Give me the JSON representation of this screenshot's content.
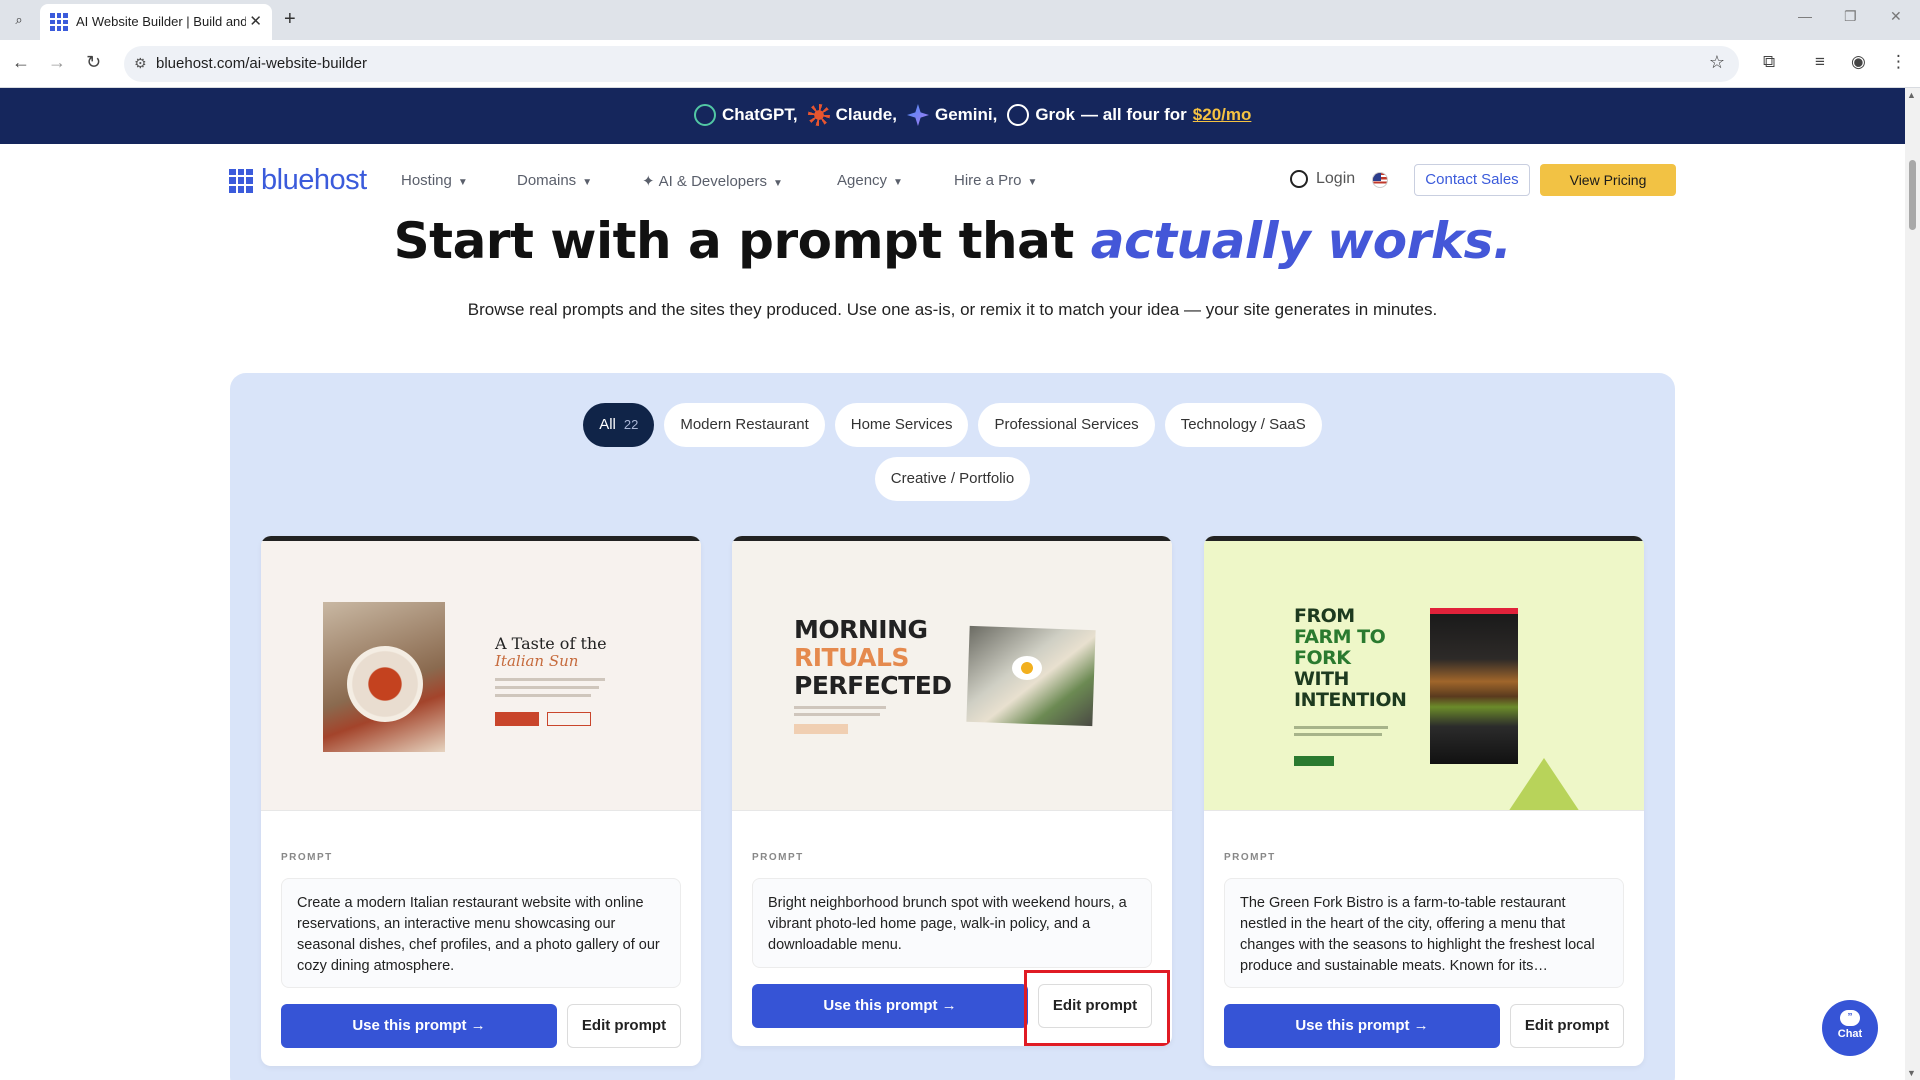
{
  "browser": {
    "tab_title": "AI Website Builder | Build and L",
    "url": "bluehost.com/ai-website-builder"
  },
  "promo": {
    "items": [
      "ChatGPT,",
      "Claude,",
      "Gemini,",
      "Grok"
    ],
    "suffix": "— all four for",
    "price": "$20/mo"
  },
  "header": {
    "logo": "bluehost",
    "nav": [
      "Hosting",
      "Domains",
      "AI & Developers",
      "Agency",
      "Hire a Pro"
    ],
    "login": "Login",
    "contact": "Contact Sales",
    "pricing": "View Pricing"
  },
  "hero": {
    "title_plain": "Start with a prompt that",
    "title_em": "actually works.",
    "subtitle": "Browse real prompts and the sites they produced. Use one as-is, or remix it to match your idea — your site generates in minutes."
  },
  "filters": [
    {
      "label": "All",
      "count": "22",
      "active": true
    },
    {
      "label": "Modern Restaurant"
    },
    {
      "label": "Home Services"
    },
    {
      "label": "Professional Services"
    },
    {
      "label": "Technology / SaaS"
    },
    {
      "label": "Creative / Portfolio"
    }
  ],
  "cards": [
    {
      "prompt_label": "PROMPT",
      "prompt": "Create a modern Italian restaurant website with online reservations, an interactive menu showcasing our seasonal dishes, chef profiles, and a photo gallery of our cozy dining atmosphere.",
      "use_label": "Use this prompt →",
      "edit_label": "Edit prompt",
      "shot": {
        "title": "A Taste of the",
        "title_em": "Italian Sun"
      }
    },
    {
      "prompt_label": "PROMPT",
      "prompt": "Bright neighborhood brunch spot with weekend hours, a vibrant photo-led home page, walk-in policy, and a downloadable menu.",
      "use_label": "Use this prompt →",
      "edit_label": "Edit prompt",
      "shot": {
        "line1": "MORNING",
        "line2": "RITUALS",
        "line3": "PERFECTED"
      }
    },
    {
      "prompt_label": "PROMPT",
      "prompt": "The Green Fork Bistro is a farm-to-table restaurant nestled in the heart of the city, offering a menu that changes with the seasons to highlight the freshest local produce and sustainable meats. Known for its…",
      "use_label": "Use this prompt →",
      "edit_label": "Edit prompt",
      "shot": {
        "line1": "FROM",
        "line2": "FARM TO",
        "line3": "FORK",
        "line4": "WITH",
        "line5": "INTENTION"
      }
    }
  ],
  "chat": {
    "label": "Chat"
  }
}
